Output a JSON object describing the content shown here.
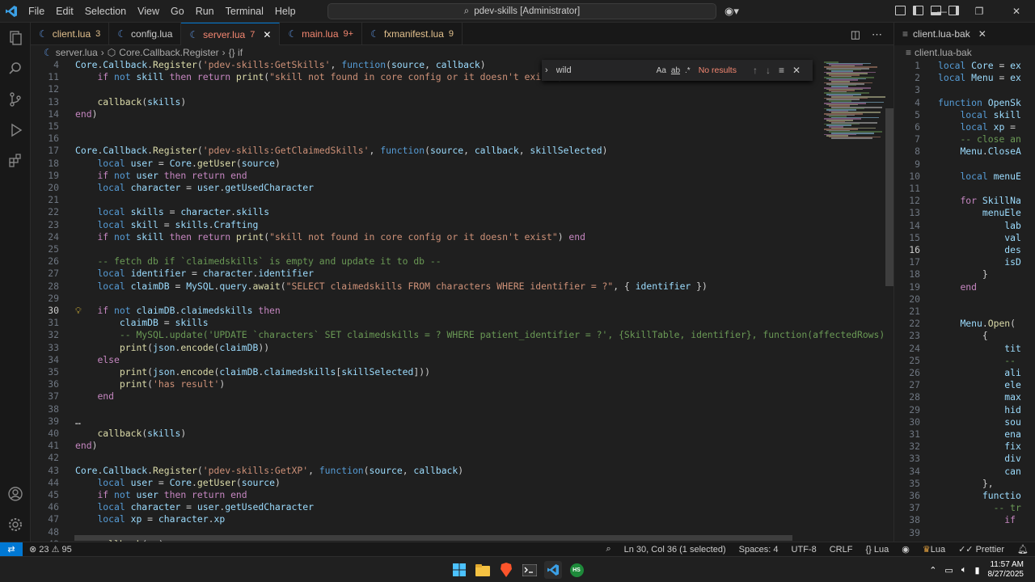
{
  "menu": [
    "File",
    "Edit",
    "Selection",
    "View",
    "Go",
    "Run",
    "Terminal",
    "Help"
  ],
  "command_center": "pdev-skills [Administrator]",
  "tabs": [
    {
      "label": "client.lua",
      "badge": "3",
      "active": false
    },
    {
      "label": "config.lua",
      "badge": "",
      "active": false
    },
    {
      "label": "server.lua",
      "badge": "7",
      "active": true
    },
    {
      "label": "main.lua",
      "badge": "9+",
      "active": false
    },
    {
      "label": "fxmanifest.lua",
      "badge": "9",
      "active": false
    }
  ],
  "breadcrumbs": [
    "server.lua",
    "Core.Callback.Register",
    "{} if"
  ],
  "find": {
    "query": "wild",
    "status": "No results",
    "opt_case": "Aa",
    "opt_word": "ab",
    "opt_regex": ".*"
  },
  "editor_lines": [
    {
      "n": "4",
      "text": "Core.Callback.Register('pdev-skills:GetSkills', function(source, callback)"
    },
    {
      "n": "11",
      "text": "    if not skill then return print(\"skill not found in core config or it doesn't exist\") end"
    },
    {
      "n": "12",
      "text": ""
    },
    {
      "n": "13",
      "text": "    callback(skills)"
    },
    {
      "n": "14",
      "text": "end)"
    },
    {
      "n": "15",
      "text": ""
    },
    {
      "n": "16",
      "text": ""
    },
    {
      "n": "17",
      "text": "Core.Callback.Register('pdev-skills:GetClaimedSkills', function(source, callback, skillSelected)"
    },
    {
      "n": "18",
      "text": "    local user = Core.getUser(source)"
    },
    {
      "n": "19",
      "text": "    if not user then return end"
    },
    {
      "n": "20",
      "text": "    local character = user.getUsedCharacter"
    },
    {
      "n": "21",
      "text": ""
    },
    {
      "n": "22",
      "text": "    local skills = character.skills"
    },
    {
      "n": "23",
      "text": "    local skill = skills.Crafting"
    },
    {
      "n": "24",
      "text": "    if not skill then return print(\"skill not found in core config or it doesn't exist\") end"
    },
    {
      "n": "25",
      "text": ""
    },
    {
      "n": "26",
      "text": "    -- fetch db if `claimedskills` is empty and update it to db --"
    },
    {
      "n": "27",
      "text": "    local identifier = character.identifier"
    },
    {
      "n": "28",
      "text": "    local claimDB = MySQL.query.await(\"SELECT claimedskills FROM characters WHERE identifier = ?\", { identifier })"
    },
    {
      "n": "29",
      "text": ""
    },
    {
      "n": "30",
      "text": "    if not claimDB.claimedskills then"
    },
    {
      "n": "31",
      "text": "        claimDB = skills"
    },
    {
      "n": "32",
      "text": "        -- MySQL.update('UPDATE `characters` SET claimedskills = ? WHERE patient_identifier = ?', {SkillTable, identifier}, function(affectedRows) end"
    },
    {
      "n": "33",
      "text": "        print(json.encode(claimDB))"
    },
    {
      "n": "34",
      "text": "    else"
    },
    {
      "n": "35",
      "text": "        print(json.encode(claimDB.claimedskills[skillSelected]))"
    },
    {
      "n": "36",
      "text": "        print('has result')"
    },
    {
      "n": "37",
      "text": "    end"
    },
    {
      "n": "38",
      "text": ""
    },
    {
      "n": "39",
      "text": "…"
    },
    {
      "n": "40",
      "text": "    callback(skills)"
    },
    {
      "n": "41",
      "text": "end)"
    },
    {
      "n": "42",
      "text": ""
    },
    {
      "n": "43",
      "text": "Core.Callback.Register('pdev-skills:GetXP', function(source, callback)"
    },
    {
      "n": "44",
      "text": "    local user = Core.getUser(source)"
    },
    {
      "n": "45",
      "text": "    if not user then return end"
    },
    {
      "n": "46",
      "text": "    local character = user.getUsedCharacter"
    },
    {
      "n": "47",
      "text": "    local xp = character.xp"
    },
    {
      "n": "48",
      "text": ""
    },
    {
      "n": "49",
      "text": "    callback(xp)"
    }
  ],
  "right_group": {
    "tab": "client.lua-bak",
    "breadcrumb": "client.lua-bak",
    "lines": [
      {
        "n": "1",
        "text": "local Core = ex"
      },
      {
        "n": "2",
        "text": "local Menu = ex"
      },
      {
        "n": "3",
        "text": ""
      },
      {
        "n": "4",
        "text": "function OpenSk"
      },
      {
        "n": "5",
        "text": "    local skill"
      },
      {
        "n": "6",
        "text": "    local xp = "
      },
      {
        "n": "7",
        "text": "    -- close an"
      },
      {
        "n": "8",
        "text": "    Menu.CloseA"
      },
      {
        "n": "9",
        "text": ""
      },
      {
        "n": "10",
        "text": "    local menuE"
      },
      {
        "n": "11",
        "text": ""
      },
      {
        "n": "12",
        "text": "    for SkillNa"
      },
      {
        "n": "13",
        "text": "        menuEle"
      },
      {
        "n": "14",
        "text": "            lab"
      },
      {
        "n": "15",
        "text": "            val"
      },
      {
        "n": "16",
        "text": "            des"
      },
      {
        "n": "17",
        "text": "            isD"
      },
      {
        "n": "18",
        "text": "        }"
      },
      {
        "n": "19",
        "text": "    end"
      },
      {
        "n": "20",
        "text": ""
      },
      {
        "n": "21",
        "text": ""
      },
      {
        "n": "22",
        "text": "    Menu.Open(\""
      },
      {
        "n": "23",
        "text": "        {"
      },
      {
        "n": "24",
        "text": "            tit"
      },
      {
        "n": "25",
        "text": "            --"
      },
      {
        "n": "26",
        "text": "            ali"
      },
      {
        "n": "27",
        "text": "            ele"
      },
      {
        "n": "28",
        "text": "            max"
      },
      {
        "n": "29",
        "text": "            hid"
      },
      {
        "n": "30",
        "text": "            sou"
      },
      {
        "n": "31",
        "text": "            ena"
      },
      {
        "n": "32",
        "text": "            fix"
      },
      {
        "n": "33",
        "text": "            div"
      },
      {
        "n": "34",
        "text": "            can"
      },
      {
        "n": "35",
        "text": "        },"
      },
      {
        "n": "36",
        "text": "        functio"
      },
      {
        "n": "37",
        "text": "          -- tr"
      },
      {
        "n": "38",
        "text": "            if"
      },
      {
        "n": "39",
        "text": ""
      }
    ]
  },
  "status": {
    "errors": "23",
    "warnings": "95",
    "position": "Ln 30, Col 36 (1 selected)",
    "spaces": "Spaces: 4",
    "encoding": "UTF-8",
    "eol": "CRLF",
    "language": "Lua",
    "lang_mode2": "Lua",
    "prettier": "Prettier"
  },
  "taskbar": {
    "time": "11:57 AM",
    "date": "8/27/2025"
  },
  "colors": {
    "accent": "#0078d4",
    "keyword": "#c586c0",
    "function": "#dcdcaa",
    "string": "#ce9178",
    "variable": "#9cdcfe",
    "comment": "#6a9955"
  }
}
